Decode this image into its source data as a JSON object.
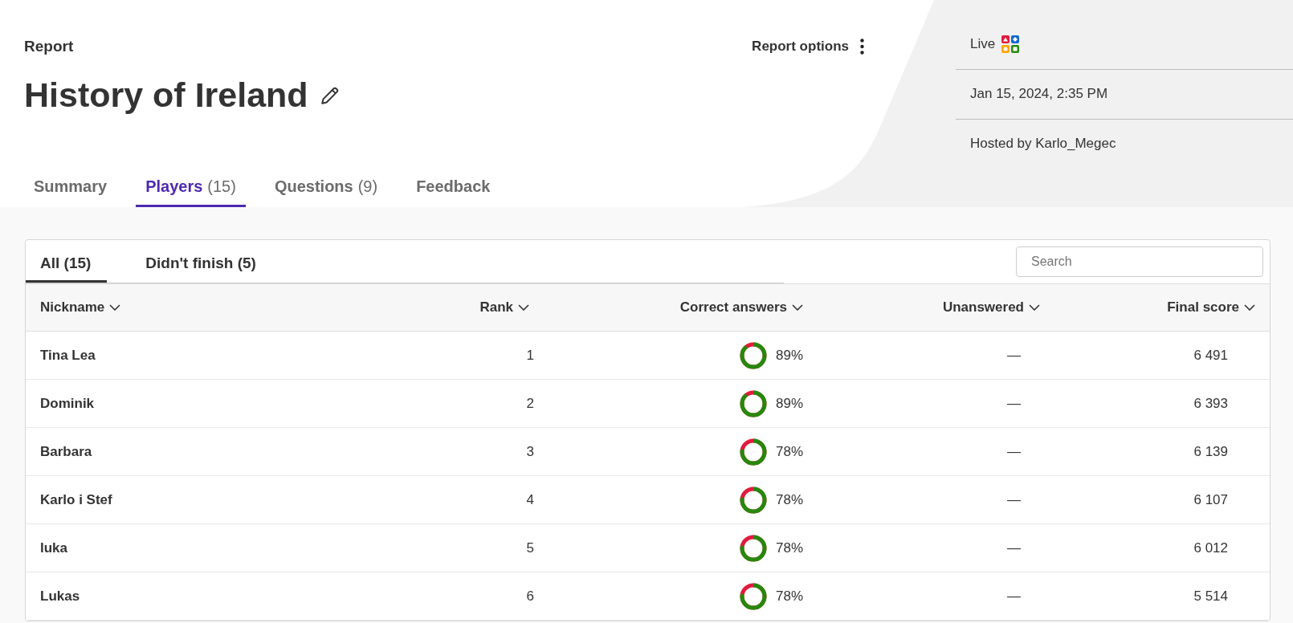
{
  "header": {
    "eyebrow": "Report",
    "title": "History of Ireland",
    "options_label": "Report options"
  },
  "info_panel": {
    "mode": "Live",
    "date": "Jan 15, 2024, 2:35 PM",
    "host": "Hosted by Karlo_Megec"
  },
  "tabs": [
    {
      "label": "Summary",
      "selected": false
    },
    {
      "label": "Players",
      "count": "(15)",
      "selected": true
    },
    {
      "label": "Questions",
      "count": "(9)",
      "selected": false
    },
    {
      "label": "Feedback",
      "selected": false
    }
  ],
  "subtabs": [
    {
      "label": "All (15)",
      "selected": true
    },
    {
      "label": "Didn't finish (5)",
      "selected": false
    }
  ],
  "search": {
    "placeholder": "Search"
  },
  "table": {
    "columns": [
      "Nickname",
      "Rank",
      "Correct answers",
      "Unanswered",
      "Final score"
    ],
    "rows": [
      {
        "nickname": "Tina Lea",
        "rank": "1",
        "correct": "89%",
        "level": 0.89,
        "unanswered": "—",
        "score": "6 491"
      },
      {
        "nickname": "Dominik",
        "rank": "2",
        "correct": "89%",
        "level": 0.89,
        "unanswered": "—",
        "score": "6 393"
      },
      {
        "nickname": "Barbara",
        "rank": "3",
        "correct": "78%",
        "level": 0.78,
        "unanswered": "—",
        "score": "6 139"
      },
      {
        "nickname": "Karlo i Stef",
        "rank": "4",
        "correct": "78%",
        "level": 0.78,
        "unanswered": "—",
        "score": "6 107"
      },
      {
        "nickname": "luka",
        "rank": "5",
        "correct": "78%",
        "level": 0.78,
        "unanswered": "—",
        "score": "6 012"
      },
      {
        "nickname": "Lukas",
        "rank": "6",
        "correct": "78%",
        "level": 0.78,
        "unanswered": "—",
        "score": "5 514"
      }
    ]
  }
}
